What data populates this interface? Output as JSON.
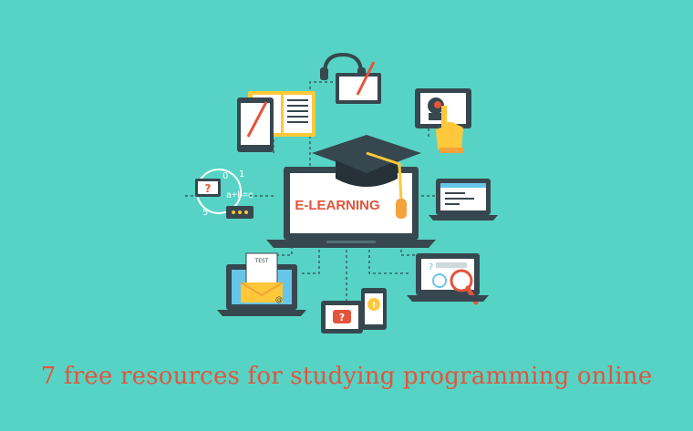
{
  "scene": {
    "laptop_screen_text": "E-LEARNING",
    "quiz_marks": [
      "?",
      "?",
      "!",
      "?"
    ],
    "formula_text": "a+b=c",
    "formula_numbers": [
      "0",
      "1",
      "5"
    ],
    "test_sheet_label": "TEST",
    "email_symbol": "@"
  },
  "caption": {
    "text": "7 free resources for studying programming online"
  },
  "colors": {
    "background": "#56d3c4",
    "dark": "#37474f",
    "screen": "#ffffff",
    "accent_red": "#e4543a",
    "accent_yellow": "#ffc83a",
    "screen_blue": "#67c6e8"
  }
}
